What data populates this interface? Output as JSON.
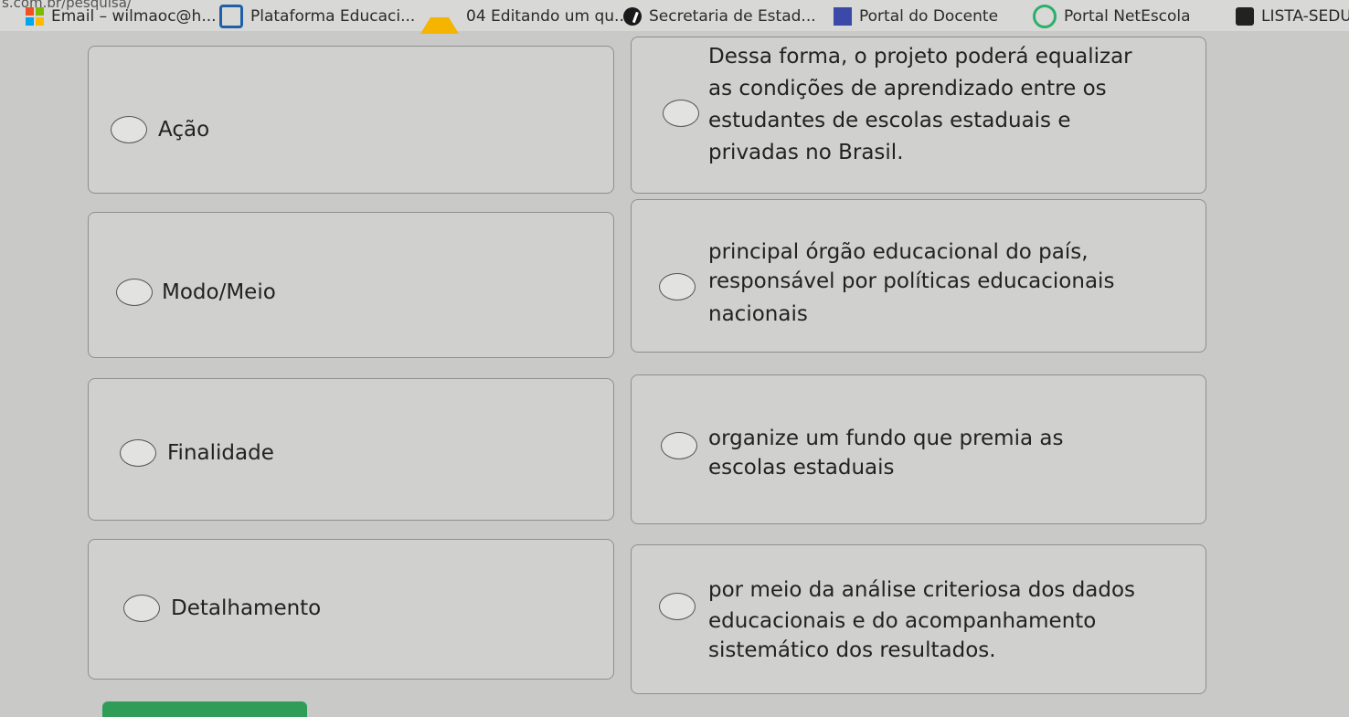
{
  "browser": {
    "url_fragment": "s.com.br/pesquisa/",
    "bookmarks": [
      {
        "label": "Email – wilmaoc@h...",
        "icon": "microsoft-icon"
      },
      {
        "label": "Plataforma Educaci...",
        "icon": "plataforma-icon"
      },
      {
        "label": "04 Editando um qu...",
        "icon": "google-drive-icon"
      },
      {
        "label": "Secretaria de Estad...",
        "icon": "secretaria-icon"
      },
      {
        "label": "Portal do Docente",
        "icon": "portal-icon"
      },
      {
        "label": "Portal NetEscola",
        "icon": "netescola-icon"
      },
      {
        "label": "LISTA-SEDU",
        "icon": "lista-icon"
      }
    ]
  },
  "matching": {
    "left": [
      {
        "label": "Ação"
      },
      {
        "label": "Modo/Meio"
      },
      {
        "label": "Finalidade"
      },
      {
        "label": "Detalhamento"
      }
    ],
    "right": [
      {
        "lines": [
          "Dessa forma, o projeto poderá equalizar",
          "as condições de aprendizado entre os",
          "estudantes de escolas estaduais e",
          "privadas no Brasil."
        ]
      },
      {
        "lines": [
          "principal órgão educacional do país,",
          "responsável por políticas educacionais",
          "nacionais"
        ]
      },
      {
        "lines": [
          "organize um fundo que premia as",
          "escolas estaduais"
        ]
      },
      {
        "lines": [
          "por meio da análise criteriosa dos dados",
          "educacionais e do acompanhamento",
          "sistemático dos resultados."
        ]
      }
    ]
  },
  "colors": {
    "accent_green": "#2f9d57"
  }
}
